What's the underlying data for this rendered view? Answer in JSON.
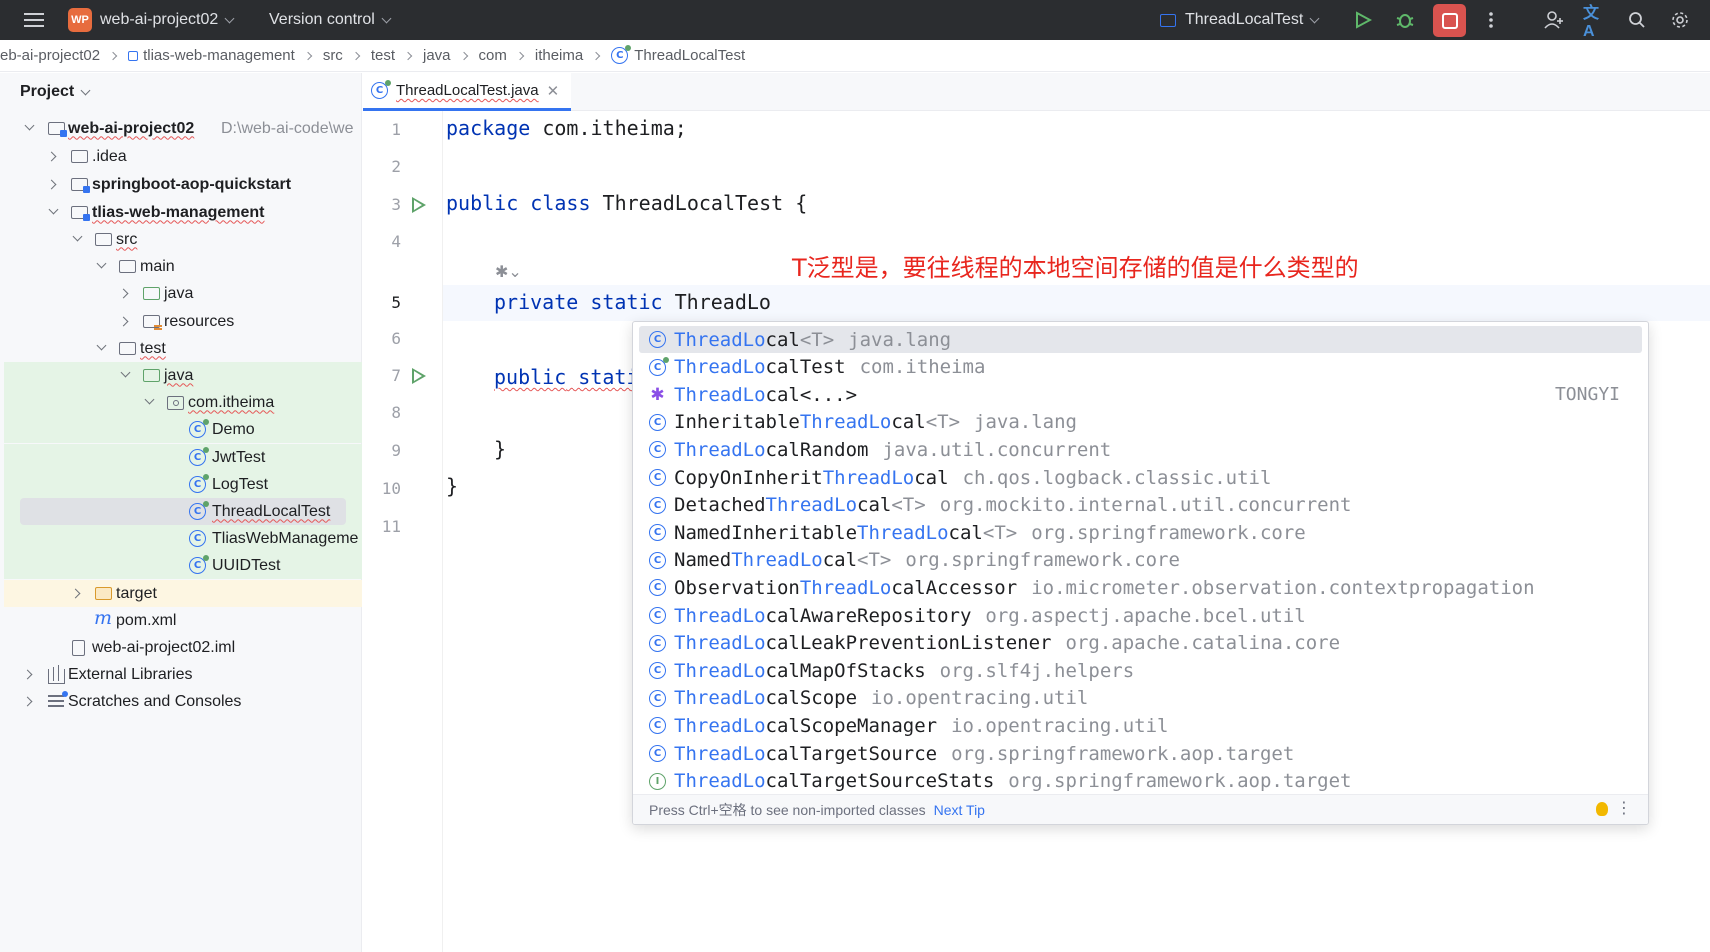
{
  "topbar": {
    "logo": "WP",
    "project_name": "web-ai-project02",
    "vcs": "Version control",
    "run_config": "ThreadLocalTest",
    "icons": [
      "hamburger-menu-icon",
      "run-icon",
      "debug-icon",
      "stop-icon",
      "more-icon",
      "add-user-icon",
      "translate-icon",
      "search-icon",
      "settings-icon"
    ]
  },
  "breadcrumb": [
    "eb-ai-project02",
    "tlias-web-management",
    "src",
    "test",
    "java",
    "com",
    "itheima",
    "ThreadLocalTest"
  ],
  "project_panel": {
    "title": "Project",
    "tree": [
      {
        "label": "web-ai-project02",
        "hint": "D:\\web-ai-code\\we"
      },
      {
        "label": ".idea"
      },
      {
        "label": "springboot-aop-quickstart"
      },
      {
        "label": "tlias-web-management"
      },
      {
        "label": "src"
      },
      {
        "label": "main"
      },
      {
        "label": "java"
      },
      {
        "label": "resources"
      },
      {
        "label": "test"
      },
      {
        "label": "java"
      },
      {
        "label": "com.itheima"
      },
      {
        "label": "Demo"
      },
      {
        "label": "JwtTest"
      },
      {
        "label": "LogTest"
      },
      {
        "label": "ThreadLocalTest"
      },
      {
        "label": "TliasWebManageme"
      },
      {
        "label": "UUIDTest"
      },
      {
        "label": "target"
      },
      {
        "label": "pom.xml"
      },
      {
        "label": "web-ai-project02.iml"
      },
      {
        "label": "External Libraries"
      },
      {
        "label": "Scratches and Consoles"
      }
    ]
  },
  "editor": {
    "tab": "ThreadLocalTest.java",
    "line_numbers": [
      "1",
      "2",
      "3",
      "4",
      "5",
      "6",
      "7",
      "8",
      "9",
      "10",
      "11"
    ],
    "code": {
      "l1_kw": "package",
      "l1_rest": " com.itheima;",
      "l3_kw": "public class",
      "l3_rest": " ThreadLocalTest {",
      "l5_kw": "private static",
      "l5_rest": " ThreadLo",
      "l7_kw": "public",
      "l7_rest": " stati",
      "l9": "}",
      "l10": "}"
    },
    "annotation": "T泛型是，要往线程的本地空间存储的值是什么类型的"
  },
  "completion": {
    "items": [
      {
        "hl": "ThreadLo",
        "rest": "cal",
        "type": "<T>",
        "pkg": "java.lang"
      },
      {
        "hl": "ThreadLo",
        "rest": "calTest",
        "type": "",
        "pkg": "com.itheima"
      },
      {
        "hl": "ThreadLo",
        "rest": "cal<...>",
        "type": "",
        "pkg": "",
        "tag": "TONGYI"
      },
      {
        "pre": "Inheritable",
        "hl": "ThreadLo",
        "rest": "cal",
        "type": "<T>",
        "pkg": "java.lang"
      },
      {
        "hl": "ThreadLo",
        "rest": "calRandom",
        "type": "",
        "pkg": "java.util.concurrent"
      },
      {
        "pre": "CopyOnInherit",
        "hl": "ThreadLo",
        "rest": "cal",
        "type": "",
        "pkg": "ch.qos.logback.classic.util"
      },
      {
        "pre": "Detached",
        "hl": "ThreadLo",
        "rest": "cal",
        "type": "<T>",
        "pkg": "org.mockito.internal.util.concurrent"
      },
      {
        "pre": "NamedInheritable",
        "hl": "ThreadLo",
        "rest": "cal",
        "type": "<T>",
        "pkg": "org.springframework.core"
      },
      {
        "pre": "Named",
        "hl": "ThreadLo",
        "rest": "cal",
        "type": "<T>",
        "pkg": "org.springframework.core"
      },
      {
        "pre": "Observation",
        "hl": "ThreadLo",
        "rest": "calAccessor",
        "type": "",
        "pkg": "io.micrometer.observation.contextpropagation"
      },
      {
        "hl": "ThreadLo",
        "rest": "calAwareRepository",
        "type": "",
        "pkg": "org.aspectj.apache.bcel.util"
      },
      {
        "hl": "ThreadLo",
        "rest": "calLeakPreventionListener",
        "type": "",
        "pkg": "org.apache.catalina.core"
      },
      {
        "hl": "ThreadLo",
        "rest": "calMapOfStacks",
        "type": "",
        "pkg": "org.slf4j.helpers"
      },
      {
        "hl": "ThreadLo",
        "rest": "calScope",
        "type": "",
        "pkg": "io.opentracing.util"
      },
      {
        "hl": "ThreadLo",
        "rest": "calScopeManager",
        "type": "",
        "pkg": "io.opentracing.util"
      },
      {
        "hl": "ThreadLo",
        "rest": "calTargetSource",
        "type": "",
        "pkg": "org.springframework.aop.target"
      },
      {
        "hl": "ThreadLo",
        "rest": "calTargetSourceStats",
        "type": "",
        "pkg": "org.springframework.aop.target"
      }
    ],
    "footer_text": "Press Ctrl+空格 to see non-imported classes",
    "footer_link": "Next Tip"
  }
}
